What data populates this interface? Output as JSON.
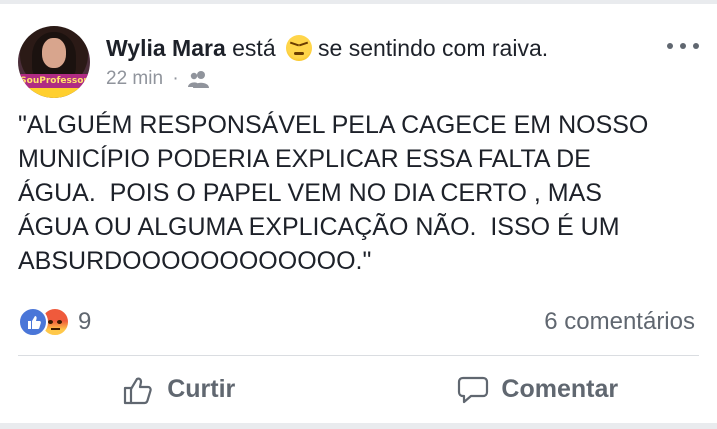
{
  "post": {
    "author": "Wylia Mara",
    "feeling_prefix": "está",
    "feeling_text": "se sentindo com raiva.",
    "feeling_icon": "angry-face-emoji",
    "time": "22 min",
    "separator": "·",
    "audience_icon": "friends-icon",
    "avatar_banner": "SouProfessor",
    "body": "\"ALGUÉM RESPONSÁVEL PELA CAGECE EM NOSSO\nMUNICÍPIO PODERIA EXPLICAR ESSA FALTA DE\nÁGUA.  POIS O PAPEL VEM NO DIA CERTO , MAS\nÁGUA OU ALGUMA EXPLICAÇÃO NÃO.  ISSO É UM\nABSURDOOOOOOOOOOOO.\""
  },
  "reactions": {
    "icons": [
      "like-reaction-icon",
      "angry-reaction-icon"
    ],
    "count": "9",
    "comments": "6 comentários"
  },
  "actions": {
    "like_label": "Curtir",
    "comment_label": "Comentar"
  },
  "colors": {
    "background": "#e9ebee",
    "card": "#ffffff",
    "text": "#1d2129",
    "muted": "#606770",
    "like_blue": "#4a76d8"
  }
}
